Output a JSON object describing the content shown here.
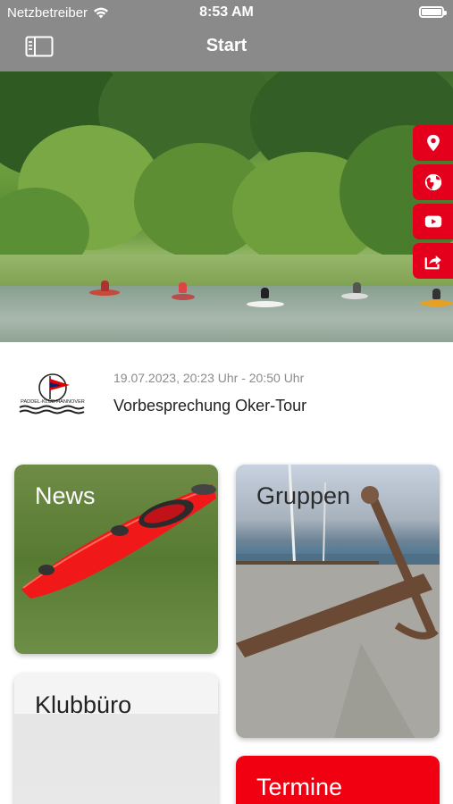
{
  "status": {
    "carrier": "Netzbetreiber",
    "time": "8:53 AM"
  },
  "nav": {
    "title": "Start"
  },
  "side_actions": [
    {
      "icon": "location-pin-icon"
    },
    {
      "icon": "globe-icon"
    },
    {
      "icon": "youtube-icon"
    },
    {
      "icon": "share-icon"
    }
  ],
  "event": {
    "date": "19.07.2023, 20:23 Uhr - 20:50 Uhr",
    "title": "Vorbesprechung Oker-Tour",
    "logo_text": "PADDEL-KLUB HANNOVER"
  },
  "tiles": {
    "news": "News",
    "gruppen": "Gruppen",
    "klubburo": "Klubbüro",
    "termine": "Termine"
  },
  "colors": {
    "accent": "#e4001c",
    "navbar": "#8a8a8a"
  }
}
